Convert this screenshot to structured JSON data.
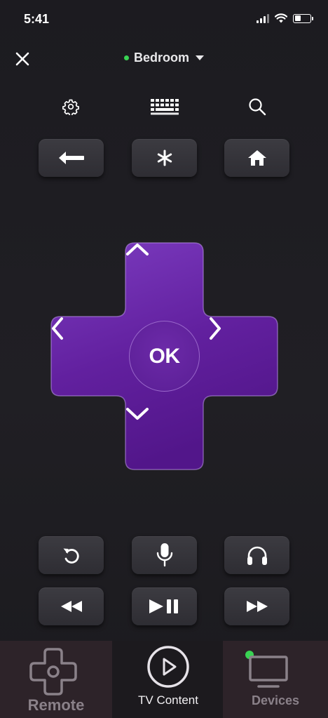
{
  "status_bar": {
    "time": "5:41"
  },
  "header": {
    "device_name": "Bedroom"
  },
  "dpad": {
    "ok_label": "OK"
  },
  "tabs": [
    {
      "label": "Remote"
    },
    {
      "label": "TV Content"
    },
    {
      "label": "Devices"
    }
  ],
  "colors": {
    "accent": "#6a23a8",
    "online": "#39d353",
    "background": "#1e1d22",
    "button": "#34333a"
  },
  "icons": {
    "top_row": [
      "gear-icon",
      "keyboard-icon",
      "search-icon"
    ],
    "nav_row": [
      "back-arrow-icon",
      "asterisk-icon",
      "home-icon"
    ],
    "row_1": [
      "replay-icon",
      "microphone-icon",
      "headphones-icon"
    ],
    "row_2": [
      "rewind-icon",
      "play-pause-icon",
      "fast-forward-icon"
    ]
  }
}
